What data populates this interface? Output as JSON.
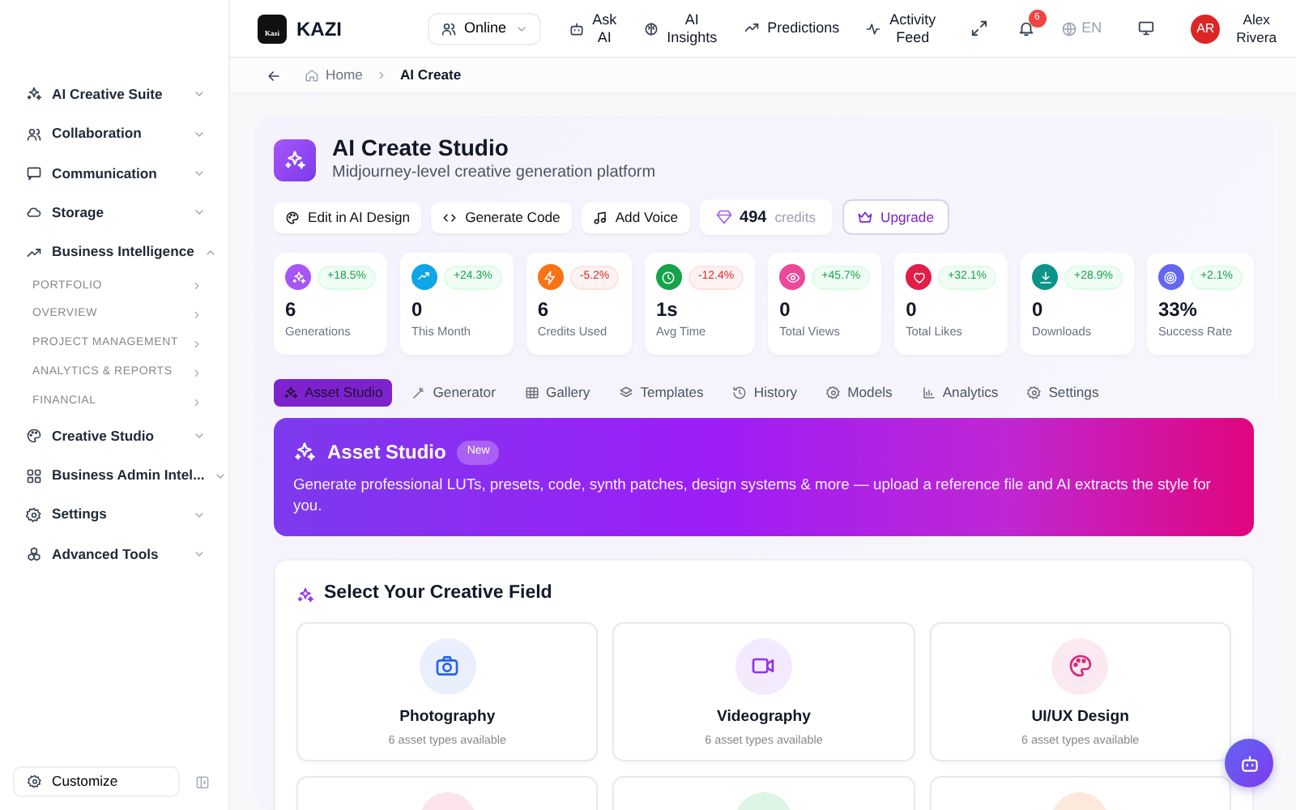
{
  "header": {
    "brand": "KAZI",
    "logo_text": "Kazi",
    "status": "Online",
    "nav": [
      {
        "label": "Ask AI"
      },
      {
        "label": "AI Insights"
      },
      {
        "label": "Predictions"
      },
      {
        "label": "Activity Feed"
      }
    ],
    "notifications": "6",
    "language": "EN",
    "user": {
      "initials": "AR",
      "name": "Alex Rivera"
    }
  },
  "sidebar": {
    "items": [
      {
        "label": "AI Creative Suite",
        "expanded": false
      },
      {
        "label": "Collaboration",
        "expanded": false
      },
      {
        "label": "Communication",
        "expanded": false
      },
      {
        "label": "Storage",
        "expanded": false
      },
      {
        "label": "Business Intelligence",
        "expanded": true,
        "children": [
          {
            "label": "PORTFOLIO"
          },
          {
            "label": "OVERVIEW"
          },
          {
            "label": "PROJECT MANAGEMENT"
          },
          {
            "label": "ANALYTICS & REPORTS"
          },
          {
            "label": "FINANCIAL"
          }
        ]
      },
      {
        "label": "Creative Studio",
        "expanded": false
      },
      {
        "label": "Business Admin Intel...",
        "expanded": false
      },
      {
        "label": "Settings",
        "expanded": false
      },
      {
        "label": "Advanced Tools",
        "expanded": false
      }
    ],
    "customize": "Customize"
  },
  "breadcrumb": [
    "Home",
    "AI Create"
  ],
  "studio": {
    "title": "AI Create Studio",
    "subtitle": "Midjourney-level creative generation platform",
    "actions": [
      "Edit in AI Design",
      "Generate Code",
      "Add Voice"
    ],
    "credits": {
      "value": "494",
      "label": "credits"
    },
    "upgrade": "Upgrade"
  },
  "stats": [
    {
      "value": "6",
      "label": "Generations",
      "change": "+18.5%",
      "positive": true,
      "color": "#a855f7"
    },
    {
      "value": "0",
      "label": "This Month",
      "change": "+24.3%",
      "positive": true,
      "color": "#0ea5e9"
    },
    {
      "value": "6",
      "label": "Credits Used",
      "change": "-5.2%",
      "positive": false,
      "color": "#f97316"
    },
    {
      "value": "1s",
      "label": "Avg Time",
      "change": "-12.4%",
      "positive": false,
      "color": "#16a34a"
    },
    {
      "value": "0",
      "label": "Total Views",
      "change": "+45.7%",
      "positive": true,
      "color": "#ec4899"
    },
    {
      "value": "0",
      "label": "Total Likes",
      "change": "+32.1%",
      "positive": true,
      "color": "#e11d48"
    },
    {
      "value": "0",
      "label": "Downloads",
      "change": "+28.9%",
      "positive": true,
      "color": "#0d9488"
    },
    {
      "value": "33%",
      "label": "Success Rate",
      "change": "+2.1%",
      "positive": true,
      "color": "#6366f1"
    }
  ],
  "tabs": [
    {
      "label": "Asset Studio",
      "selected": true
    },
    {
      "label": "Generator",
      "selected": false
    },
    {
      "label": "Gallery",
      "selected": false
    },
    {
      "label": "Templates",
      "selected": false
    },
    {
      "label": "History",
      "selected": false
    },
    {
      "label": "Models",
      "selected": false
    },
    {
      "label": "Analytics",
      "selected": false
    },
    {
      "label": "Settings",
      "selected": false
    }
  ],
  "banner": {
    "title": "Asset Studio",
    "badge": "New",
    "text": "Generate professional LUTs, presets, code, synth patches, design systems & more — upload a reference file and AI extracts the style for you."
  },
  "fields": {
    "title": "Select Your Creative Field",
    "items": [
      {
        "name": "Photography",
        "detail": "6 asset types available",
        "color": "#2563eb"
      },
      {
        "name": "Videography",
        "detail": "6 asset types available",
        "color": "#9333ea"
      },
      {
        "name": "UI/UX Design",
        "detail": "6 asset types available",
        "color": "#db2777"
      },
      {
        "color": "#fde4ea"
      },
      {
        "color": "#dcf5e4"
      },
      {
        "color": "#fde9dc"
      }
    ]
  }
}
